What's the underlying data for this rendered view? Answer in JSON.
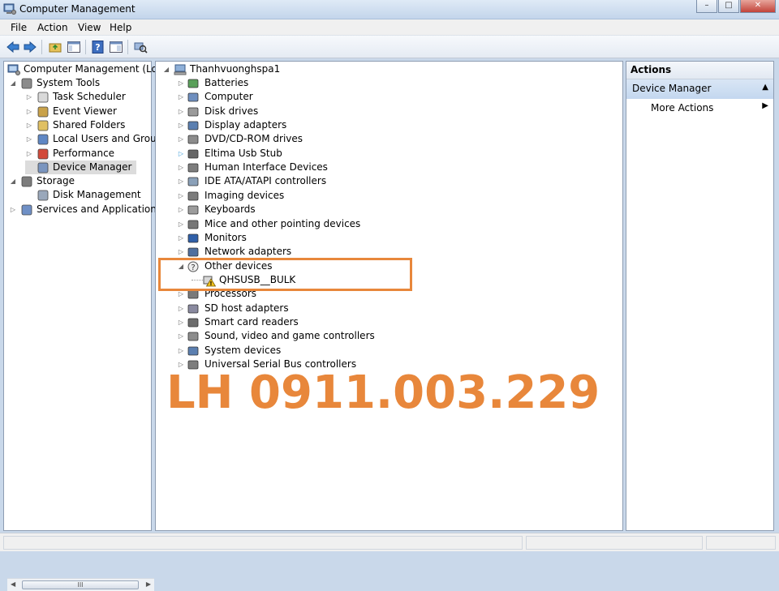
{
  "window": {
    "title": "Computer Management",
    "buttons": [
      "–",
      "□",
      "✕"
    ]
  },
  "menu": [
    "File",
    "Action",
    "View",
    "Help"
  ],
  "left_tree": {
    "root": "Computer Management (Local",
    "items": [
      {
        "label": "System Tools",
        "level": 1,
        "expand": "◢",
        "icon": "tools-icon"
      },
      {
        "label": "Task Scheduler",
        "level": 2,
        "expand": "▷",
        "icon": "clock-icon"
      },
      {
        "label": "Event Viewer",
        "level": 2,
        "expand": "▷",
        "icon": "event-viewer-icon"
      },
      {
        "label": "Shared Folders",
        "level": 2,
        "expand": "▷",
        "icon": "shared-folders-icon"
      },
      {
        "label": "Local Users and Groups",
        "level": 2,
        "expand": "▷",
        "icon": "users-icon"
      },
      {
        "label": "Performance",
        "level": 2,
        "expand": "▷",
        "icon": "performance-icon"
      },
      {
        "label": "Device Manager",
        "level": 2,
        "expand": "",
        "icon": "device-manager-icon",
        "selected": true
      },
      {
        "label": "Storage",
        "level": 1,
        "expand": "◢",
        "icon": "storage-icon"
      },
      {
        "label": "Disk Management",
        "level": 2,
        "expand": "",
        "icon": "disk-icon"
      },
      {
        "label": "Services and Applications",
        "level": 1,
        "expand": "▷",
        "icon": "services-icon"
      }
    ],
    "scroll_glyph": "III"
  },
  "device_tree": {
    "computer": "Thanhvuonghspa1",
    "categories": [
      "Batteries",
      "Computer",
      "Disk drives",
      "Display adapters",
      "DVD/CD-ROM drives",
      "Eltima Usb Stub",
      "Human Interface Devices",
      "IDE ATA/ATAPI controllers",
      "Imaging devices",
      "Keyboards",
      "Mice and other pointing devices",
      "Monitors",
      "Network adapters",
      "Other devices",
      "Processors",
      "SD host adapters",
      "Smart card readers",
      "Sound, video and game controllers",
      "System devices",
      "Universal Serial Bus controllers"
    ],
    "other_device_child": "QHSUSB__BULK"
  },
  "actions": {
    "header": "Actions",
    "section": "Device Manager",
    "more": "More Actions"
  },
  "overlay": {
    "contact": "LH 0911.003.229"
  },
  "colors": {
    "accent": "#e8873b",
    "selected_bg": "#dcdcdc",
    "actions_section_bg": "#c9dbf1"
  }
}
